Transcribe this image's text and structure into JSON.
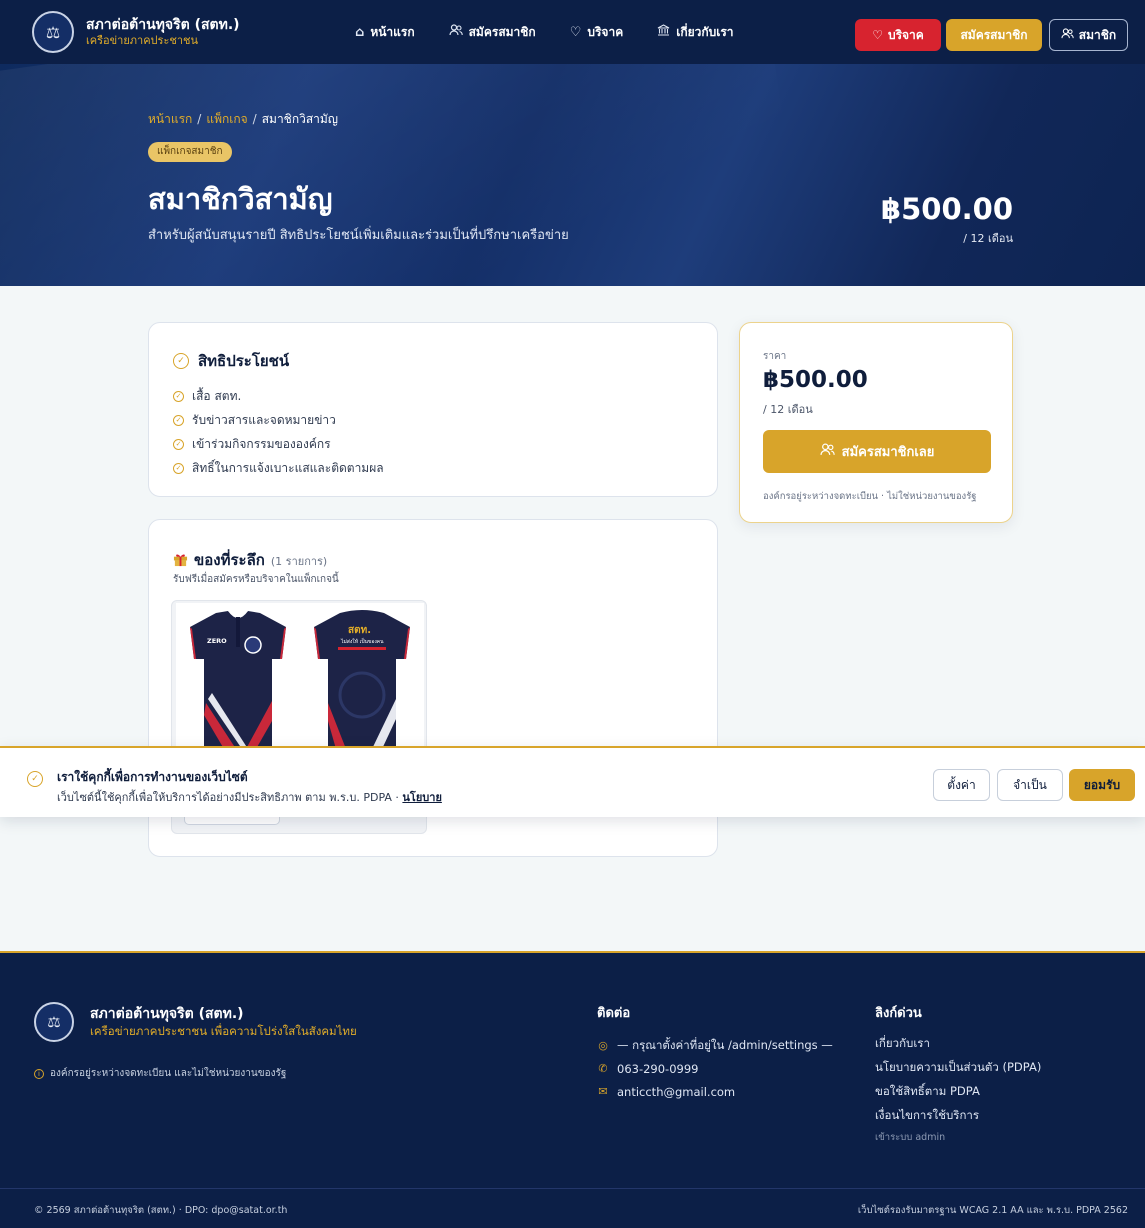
{
  "header": {
    "org_name": "สภาต่อต้านทุจริต (สตท.)",
    "org_tagline": "เครือข่ายภาคประชาชน",
    "nav": [
      {
        "label": "หน้าแรก",
        "icon": "home-icon"
      },
      {
        "label": "สมัครสมาชิก",
        "icon": "users-icon"
      },
      {
        "label": "บริจาค",
        "icon": "heart-icon"
      },
      {
        "label": "เกี่ยวกับเรา",
        "icon": "building-icon"
      }
    ],
    "donate_button": "บริจาค",
    "join_button": "สมัครสมาชิก",
    "member_button": "สมาชิก"
  },
  "hero": {
    "breadcrumb": [
      "หน้าแรก",
      "แพ็กเกจ",
      "สมาชิกวิสามัญ"
    ],
    "badge": "แพ็กเกจสมาชิก",
    "title": "สมาชิกวิสามัญ",
    "description": "สำหรับผู้สนับสนุนรายปี สิทธิประโยชน์เพิ่มเติมและร่วมเป็นที่ปรึกษาเครือข่าย",
    "price": "฿500.00",
    "period": "/ 12 เดือน"
  },
  "benefits": {
    "title": "สิทธิประโยชน์",
    "items": [
      "เสื้อ สตท.",
      "รับข่าวสารและจดหมายข่าว",
      "เข้าร่วมกิจกรรมขององค์กร",
      "สิทธิ์ในการแจ้งเบาะแสและติดตามผล"
    ]
  },
  "price_card": {
    "label": "ราคา",
    "price": "฿500.00",
    "period": "/ 12 เดือน",
    "cta": "สมัครสมาชิกเลย",
    "note": "องค์กรอยู่ระหว่างจดทะเบียน · ไม่ใช่หน่วยงานของรัฐ"
  },
  "souvenir": {
    "title": "ของที่ระลึก",
    "count": "(1 รายการ)",
    "subtitle": "รับฟรีเมื่อสมัครหรือบริจาคในแพ็กเกจนี้",
    "shirt_front_text": "ZERO",
    "shirt_back_title": "สตท.",
    "shirt_back_line1": "ไม่ส่งให้ เป็นของคน"
  },
  "cookie": {
    "title": "เราใช้คุกกี้เพื่อการทำงานของเว็บไซต์",
    "text": "เว็บไซต์นี้ใช้คุกกี้เพื่อให้บริการได้อย่างมีประสิทธิภาพ ตาม พ.ร.บ. PDPA · ",
    "policy_link": "นโยบาย",
    "settings_button": "ตั้งค่า",
    "necessary_button": "จำเป็น",
    "accept_button": "ยอมรับ"
  },
  "footer": {
    "org_name": "สภาต่อต้านทุจริต (สตท.)",
    "org_tagline": "เครือข่ายภาคประชาชน เพื่อความโปร่งใสในสังคมไทย",
    "note": "องค์กรอยู่ระหว่างจดทะเบียน และไม่ใช่หน่วยงานของรัฐ",
    "contact_title": "ติดต่อ",
    "address": "— กรุณาตั้งค่าที่อยู่ใน /admin/settings —",
    "phone": "063-290-0999",
    "email": "anticcth@gmail.com",
    "links_title": "ลิงก์ด่วน",
    "links": [
      "เกี่ยวกับเรา",
      "นโยบายความเป็นส่วนตัว (PDPA)",
      "ขอใช้สิทธิ์ตาม PDPA",
      "เงื่อนไขการใช้บริการ"
    ],
    "admin_link": "เข้าระบบ admin",
    "copyright": "© 2569 สภาต่อต้านทุจริต (สตท.) · DPO: dpo@satat.or.th",
    "wcag": "เว็บไซต์รองรับมาตรฐาน WCAG 2.1 AA และ พ.ร.บ. PDPA 2562"
  },
  "colors": {
    "navy": "#0c1f47",
    "gold": "#d8a42a",
    "red": "#d7232f"
  }
}
